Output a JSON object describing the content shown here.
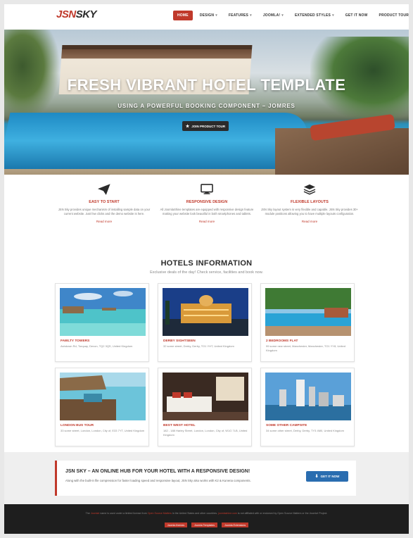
{
  "header": {
    "logo_red": "JSN",
    "logo_dark": "SKY",
    "nav": [
      {
        "label": "Home",
        "caret": false,
        "active": true
      },
      {
        "label": "Design",
        "caret": true,
        "active": false
      },
      {
        "label": "Features",
        "caret": true,
        "active": false
      },
      {
        "label": "Joomla!",
        "caret": true,
        "active": false
      },
      {
        "label": "Extended Styles",
        "caret": true,
        "active": false
      },
      {
        "label": "Get it now",
        "caret": false,
        "active": false
      },
      {
        "label": "Product tour",
        "caret": false,
        "active": false
      }
    ]
  },
  "hero": {
    "title": "FRESH VIBRANT HOTEL TEMPLATE",
    "subtitle": "USING A POWERFUL BOOKING COMPONENT – JOMRES",
    "button": "JOIN PRODUCT TOUR"
  },
  "features": [
    {
      "icon": "paper-plane-icon",
      "title": "Easy to start",
      "text": "JSN Sky provides unique mechanism of installing sample data on your current website. Just few clicks and the demo website is here.",
      "more": "Read more"
    },
    {
      "icon": "monitor-icon",
      "title": "Responsive design",
      "text": "All JoomlaShine templates are equipped with responsive design feature making your website look beautiful in both smartphones and tablets.",
      "more": "Read more"
    },
    {
      "icon": "layers-icon",
      "title": "Flexible layouts",
      "text": "JSN Sky layout system is very flexible and capable. JSN Sky provides 30+ module positions allowing you to have multiple layouts configuration.",
      "more": "Read more"
    }
  ],
  "hotels": {
    "title": "HOTELS INFORMATION",
    "subtitle": "Exclusive deals of the day! Check service, facilities and book now.",
    "cards": [
      {
        "name": "Fawlty Towers",
        "address": "Ashdown Rd, Torquay, Devon, TQ2 3QS, United Kingdom",
        "image": "beach-resort"
      },
      {
        "name": "Derby Sightseen",
        "address": "32 some street, Derby, Derby, TO1 YHT, United Kingdom",
        "image": "palace-night"
      },
      {
        "name": "2 Bedrooms Flat",
        "address": "99 some new street, Manchester, Manchester, TO1 YY8, United Kingdom",
        "image": "pool-palms"
      },
      {
        "name": "London Bus Tour",
        "address": "33 some street, London, London, City of, E33 7YT, United Kingdom",
        "image": "bungalow-deck"
      },
      {
        "name": "Best West Hotel",
        "address": "182 - 188 Harley Street, London, London, City of, W1G 7LB, United Kingdom",
        "image": "hotel-room"
      },
      {
        "name": "Some other campsite",
        "address": "34 some other street, Derby, Derby, TY3 4M0, United Kingdom",
        "image": "city-skyline"
      }
    ]
  },
  "promo": {
    "title": "JSN SKY – AN ONLINE HUB FOR YOUR HOTEL WITH A RESPONSIVE DESIGN!",
    "text": "Along with the built-in file compression for faster loading speed and responsive layout, JSN Sky also works with K2 & Kunena components.",
    "button": "GET IT NOW"
  },
  "footer": {
    "t1": "The ",
    "h1": "Joomla!",
    "t2": " name is used under a limited license from ",
    "h2": "Open Source Matters",
    "t3": " in the United States and other countries. ",
    "h3": "joomlashine.com",
    "t4": " is not affiliated with or endorsed by Open Source Matters or the Joomla! Project.",
    "links": [
      "Joomla themes",
      "Joomla Templates",
      "Joomla Extensions"
    ]
  },
  "colors": {
    "accent": "#c0392b",
    "button_blue": "#2a6db0",
    "footer_bg": "#1e1e1e"
  }
}
